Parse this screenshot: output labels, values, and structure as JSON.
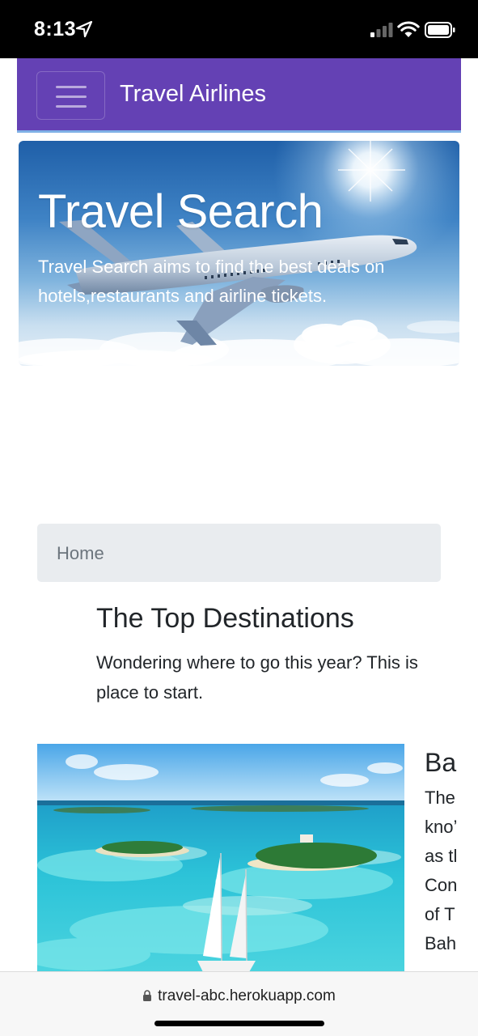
{
  "status_bar": {
    "time": "8:13"
  },
  "navbar": {
    "brand": "Travel Airlines",
    "toggle_icon": "hamburger-menu-icon"
  },
  "hero": {
    "title": "Travel Search",
    "text": "Travel Search aims to find the best deals on hotels,restaurants and airline tickets."
  },
  "breadcrumb": {
    "items": [
      "Home"
    ]
  },
  "section": {
    "title": "The Top Destinations",
    "text_lines": [
      "Wondering where to go this year? This is",
      "place to start."
    ]
  },
  "destination": {
    "title": "Ba",
    "text_lines": [
      "The",
      "kno’",
      "as tl",
      "Con",
      "of T",
      "Bah"
    ]
  },
  "url_bar": {
    "url": "travel-abc.herokuapp.com"
  }
}
